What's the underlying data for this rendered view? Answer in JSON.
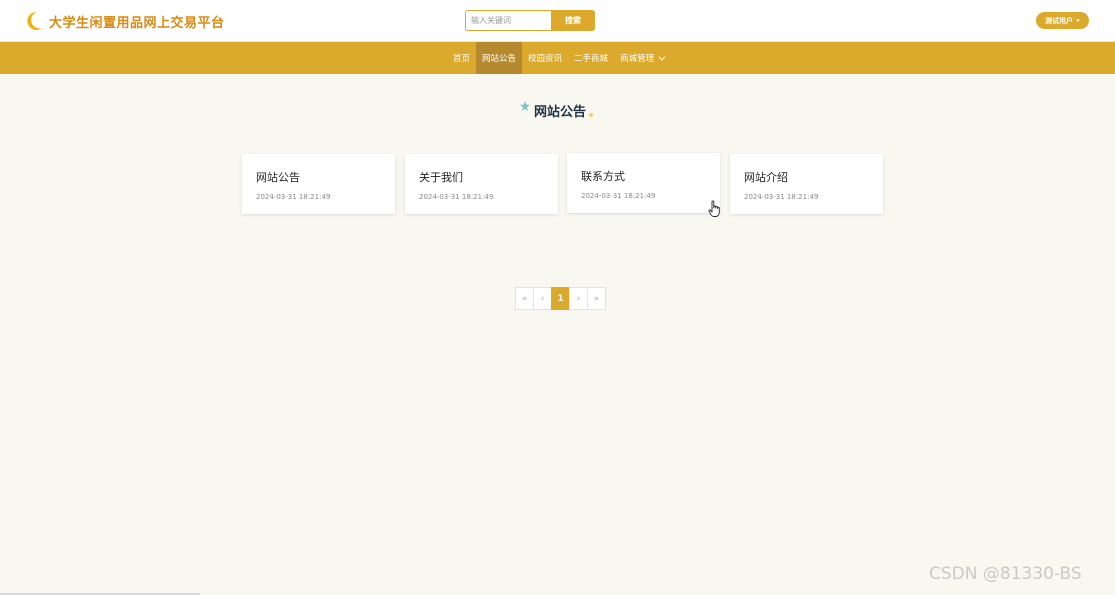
{
  "header": {
    "site_title": "大学生闲置用品网上交易平台",
    "logo_icon": "moon-icon",
    "search": {
      "placeholder": "输入关键词",
      "value": "",
      "button_label": "搜索"
    },
    "user_menu_label": "测试用户"
  },
  "nav": {
    "items": [
      {
        "label": "首页",
        "active": false
      },
      {
        "label": "网站公告",
        "active": true
      },
      {
        "label": "校园资讯",
        "active": false
      },
      {
        "label": "二手商城",
        "active": false
      },
      {
        "label": "商城管理",
        "active": false,
        "has_dropdown": true
      }
    ]
  },
  "section": {
    "title": "网站公告"
  },
  "cards": [
    {
      "title": "网站公告",
      "date": "2024-03-31 18:21:49"
    },
    {
      "title": "关于我们",
      "date": "2024-03-31 18:21:49"
    },
    {
      "title": "联系方式",
      "date": "2024-03-31 18:21:49"
    },
    {
      "title": "网站介绍",
      "date": "2024-03-31 18:21:49"
    }
  ],
  "pagination": {
    "first": "«",
    "prev": "‹",
    "current": "1",
    "next": "›",
    "last": "»"
  },
  "watermark": "CSDN @81330-BS",
  "colors": {
    "accent": "#dba92b",
    "nav_active": "#b5892d",
    "title_orange": "#d98a12",
    "background": "#f8f8f1"
  }
}
